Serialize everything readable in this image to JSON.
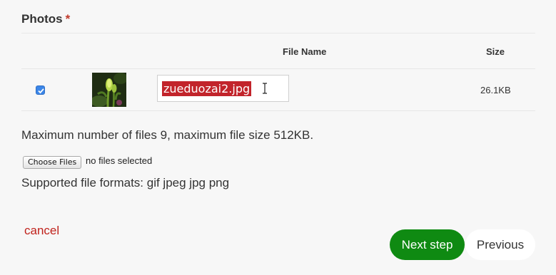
{
  "section": {
    "title": "Photos",
    "required_mark": "*"
  },
  "table": {
    "headers": {
      "file_name": "File Name",
      "size": "Size"
    },
    "rows": [
      {
        "checked": true,
        "file_name": "zueduozai2.jpg",
        "size": "26.1KB"
      }
    ]
  },
  "limits_text": "Maximum number of files 9, maximum file size 512KB.",
  "file_picker": {
    "button_label": "Choose Files",
    "status": "no files selected"
  },
  "formats_text": "Supported file formats: gif jpeg jpg png",
  "actions": {
    "cancel": "cancel",
    "next": "Next step",
    "previous": "Previous"
  },
  "colors": {
    "required": "#c0392b",
    "selection": "#c2242b",
    "next_button": "#0f8a12",
    "cancel": "#c0221c"
  },
  "icons": {
    "checkbox": "checkbox-checked-icon",
    "cursor": "text-cursor-icon"
  }
}
